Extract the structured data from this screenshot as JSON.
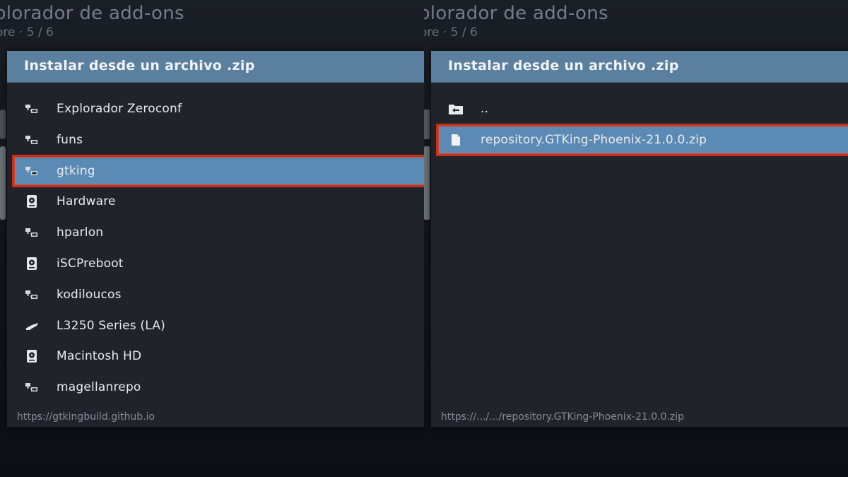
{
  "background": {
    "title_fragment": "plorador de add-ons",
    "subtitle_fragment": "ore  ·  5 / 6"
  },
  "panels": [
    {
      "dialog_title": "Instalar desde un archivo .zip",
      "items": [
        {
          "label": "Explorador Zeroconf",
          "icon": "network-share-icon",
          "focused": false
        },
        {
          "label": "funs",
          "icon": "network-share-icon",
          "focused": false
        },
        {
          "label": "gtking",
          "icon": "network-share-icon",
          "focused": true
        },
        {
          "label": "Hardware",
          "icon": "hard-drive-icon",
          "focused": false
        },
        {
          "label": "hparlon",
          "icon": "network-share-icon",
          "focused": false
        },
        {
          "label": "iSCPreboot",
          "icon": "hard-drive-icon",
          "focused": false
        },
        {
          "label": "kodiloucos",
          "icon": "network-share-icon",
          "focused": false
        },
        {
          "label": "L3250 Series (LA)",
          "icon": "printer-icon",
          "focused": false
        },
        {
          "label": "Macintosh HD",
          "icon": "hard-drive-icon",
          "focused": false
        },
        {
          "label": "magellanrepo",
          "icon": "network-share-icon",
          "focused": false
        }
      ],
      "footer_path": "https://gtkingbuild.github.io"
    },
    {
      "dialog_title": "Instalar desde un archivo .zip",
      "items": [
        {
          "label": "..",
          "icon": "parent-folder-icon",
          "focused": false
        },
        {
          "label": "repository.GTKing-Phoenix-21.0.0.zip",
          "icon": "file-icon",
          "focused": true
        }
      ],
      "footer_path": "https://.../.../repository.GTKing-Phoenix-21.0.0.zip"
    }
  ],
  "colors": {
    "header": "#5b7f9f",
    "focused_row": "#5b8bb4",
    "highlight_border": "#c4321e",
    "dialog_bg": "#20242a"
  }
}
